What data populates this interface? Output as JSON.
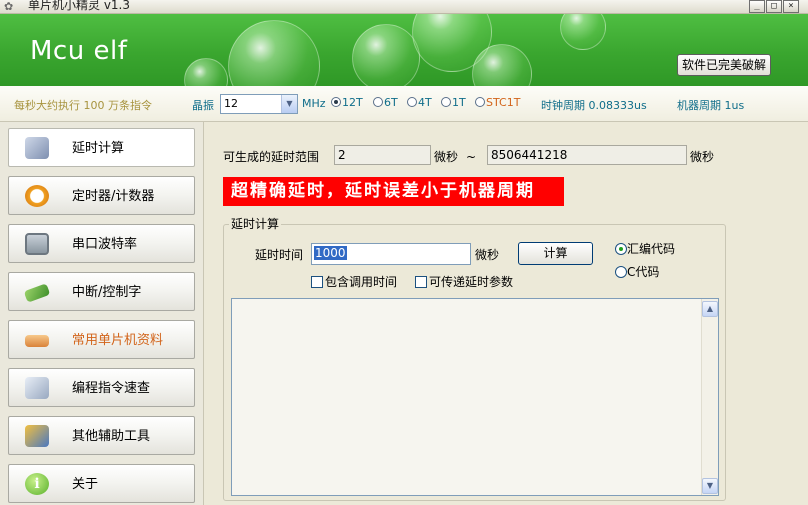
{
  "window": {
    "title": "单片机小精灵  v1.3",
    "buttons": [
      "_",
      "□",
      "×"
    ]
  },
  "banner": {
    "logo": "Mcu elf",
    "crack_button": "软件已完美破解"
  },
  "infobar": {
    "speed_text": "每秒大约执行 100 万条指令",
    "crystal_label": "晶振",
    "crystal_value": "12",
    "mhz_label": "MHz",
    "modes": [
      {
        "label": "12T",
        "selected": true
      },
      {
        "label": "6T",
        "selected": false
      },
      {
        "label": "4T",
        "selected": false
      },
      {
        "label": "1T",
        "selected": false
      },
      {
        "label": "STC1T",
        "selected": false
      }
    ],
    "clock_period": "时钟周期 0.08333us",
    "machine_period": "机器周期 1us"
  },
  "sidebar": {
    "items": [
      {
        "label": "延时计算",
        "icon": "calculator-icon",
        "active": true
      },
      {
        "label": "定时器/计数器",
        "icon": "alarm-clock-icon",
        "active": false
      },
      {
        "label": "串口波特率",
        "icon": "monitor-icon",
        "active": false
      },
      {
        "label": "中断/控制字",
        "icon": "chip-icon",
        "active": false
      },
      {
        "label": "常用单片机资料",
        "icon": "book-icon",
        "active": false,
        "highlight": true
      },
      {
        "label": "编程指令速查",
        "icon": "search-doc-icon",
        "active": false
      },
      {
        "label": "其他辅助工具",
        "icon": "tools-icon",
        "active": false
      },
      {
        "label": "关于",
        "icon": "info-icon",
        "active": false
      }
    ]
  },
  "main": {
    "range_label": "可生成的延时范围",
    "range_min": "2",
    "range_unit1": "微秒",
    "tilde": "~",
    "range_max": "8506441218",
    "range_unit2": "微秒",
    "banner_text": "超精确延时，延时误差小于机器周期",
    "group_title": "延时计算",
    "delay_label": "延时时间",
    "delay_value": "1000",
    "delay_unit": "微秒",
    "calc_button": "计算",
    "include_call_time": "包含调用时间",
    "pass_params": "可传递延时参数",
    "asm_option": "汇编代码",
    "c_option": "C代码",
    "output_text": ""
  },
  "colors": {
    "banner_green": "#3aa62f",
    "highlight_red": "#ff0000",
    "orange_text": "#d2641a",
    "teal_text": "#0f6d8a"
  }
}
